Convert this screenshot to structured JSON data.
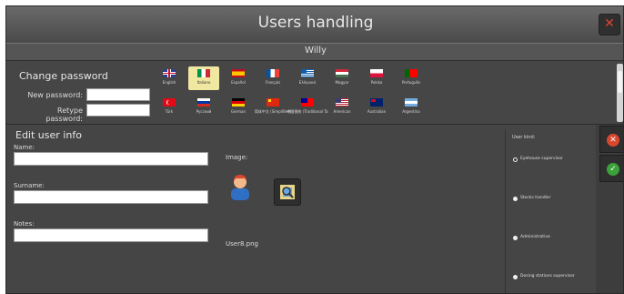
{
  "window": {
    "title": "Users handling",
    "close_icon": "close-icon",
    "accent": "#d9472f"
  },
  "user": {
    "name": "Willy"
  },
  "password": {
    "title": "Change password",
    "new_label": "New password:",
    "new_value": "",
    "retype_label": "Retype password:",
    "retype_value": ""
  },
  "languages": [
    {
      "label": "English",
      "icon": "flag-uk-icon",
      "selected": false
    },
    {
      "label": "Italiano",
      "icon": "flag-italy-icon",
      "selected": true
    },
    {
      "label": "Español",
      "icon": "flag-spain-icon",
      "selected": false
    },
    {
      "label": "Français",
      "icon": "flag-france-icon",
      "selected": false
    },
    {
      "label": "Ελληνικά",
      "icon": "flag-greece-icon",
      "selected": false
    },
    {
      "label": "Magyar",
      "icon": "flag-hungary-icon",
      "selected": false
    },
    {
      "label": "Polska",
      "icon": "flag-poland-icon",
      "selected": false
    },
    {
      "label": "Português",
      "icon": "flag-portugal-icon",
      "selected": false
    },
    {
      "label": "Türk",
      "icon": "flag-turkey-icon",
      "selected": false
    },
    {
      "label": "Русский",
      "icon": "flag-russia-icon",
      "selected": false
    },
    {
      "label": "German",
      "icon": "flag-germany-icon",
      "selected": false
    },
    {
      "label": "简体中文 (Simplified)",
      "icon": "flag-china-icon",
      "selected": false
    },
    {
      "label": "中國傳統 (Traditional Ta",
      "icon": "flag-taiwan-icon",
      "selected": false
    },
    {
      "label": "American",
      "icon": "flag-usa-icon",
      "selected": false
    },
    {
      "label": "Australian",
      "icon": "flag-australia-icon",
      "selected": false
    },
    {
      "label": "Argentina",
      "icon": "flag-argentina-icon",
      "selected": false
    }
  ],
  "edit": {
    "title": "Edit user info",
    "name_label": "Name:",
    "name_value": "",
    "surname_label": "Surname:",
    "surname_value": "",
    "notes_label": "Notes:",
    "notes_value": "",
    "image_label": "Image:",
    "image_icon": "user-avatar-icon",
    "browse_icon": "browse-image-icon",
    "filename": "User8.png"
  },
  "user_kind": {
    "title": "User kind:",
    "options": [
      {
        "label": "Eyehouse supervisor",
        "checked": true
      },
      {
        "label": "Stocks handler",
        "checked": false
      },
      {
        "label": "Administrative",
        "checked": false
      },
      {
        "label": "Dosing stations supervisor",
        "checked": false
      }
    ]
  },
  "actions": {
    "cancel_icon": "cancel-icon",
    "cancel_color": "#d9472f",
    "confirm_icon": "confirm-check-icon",
    "confirm_color": "#3aa23a"
  }
}
